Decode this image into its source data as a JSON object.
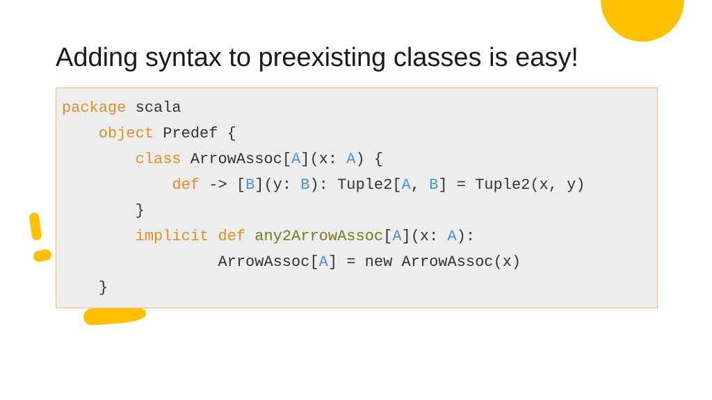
{
  "title": "Adding syntax to preexisting classes is easy!",
  "code": {
    "kw_package": "package",
    "pkg_name": " scala",
    "kw_object": "object",
    "obj_name": " Predef {",
    "kw_class": "class",
    "cls_name": " ArrowAssoc[",
    "tp_A1": "A",
    "cls_after_tp": "](x: ",
    "tp_A2": "A",
    "cls_tail": ") {",
    "kw_def": "def",
    "arrow": " -> [",
    "tp_B1": "B",
    "def_mid1": "](y: ",
    "tp_B2": "B",
    "def_mid2": "): Tuple2[",
    "tp_A3": "A",
    "comma": ", ",
    "tp_B3": "B",
    "def_tail": "] = Tuple2(x, y)",
    "brace_close1": "}",
    "kw_implicit": "implicit",
    "kw_def2": "def",
    "fn_any2": "any2ArrowAssoc",
    "impl_open": "[",
    "tp_A4": "A",
    "impl_mid": "](x: ",
    "tp_A5": "A",
    "impl_tail": "):",
    "ret_pre": "ArrowAssoc[",
    "tp_A6": "A",
    "ret_post": "] = new ArrowAssoc(x)",
    "brace_close2": "}",
    "ind1": "    ",
    "ind2": "        ",
    "ind3": "            ",
    "ind_ret": "                 ",
    "sp": " "
  }
}
